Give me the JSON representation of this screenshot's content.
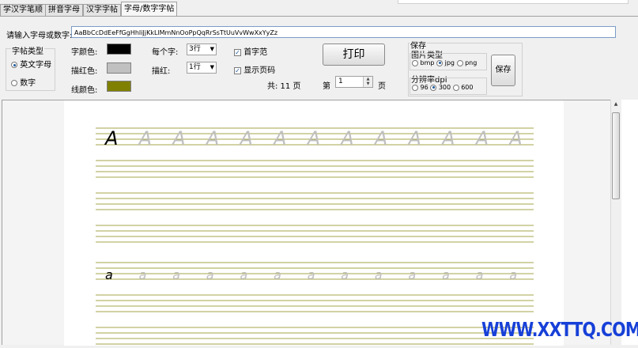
{
  "tabs": [
    {
      "label": "学汉字笔顺",
      "active": false
    },
    {
      "label": "拼音字母",
      "active": false
    },
    {
      "label": "汉字字帖",
      "active": false
    },
    {
      "label": "字母/数字字帖",
      "active": true
    }
  ],
  "input": {
    "label": "请输入字母或数字:",
    "value": "AaBbCcDdEeFfGgHhIiJjKkLlMmNnOoPpQqRrSsTtUuVvWwXxYyZz"
  },
  "type_group": {
    "title": "字帖类型",
    "options": [
      "英文字母",
      "数字"
    ],
    "selected": 0
  },
  "colors": {
    "char_label": "字颜色:",
    "char_color": "#000000",
    "trace_label": "描红色:",
    "trace_color": "#c0c0c0",
    "line_label": "线颜色:",
    "line_color": "#808000"
  },
  "per_char": {
    "label": "每个字:",
    "value": "3行"
  },
  "trace": {
    "label": "描红:",
    "value": "1行"
  },
  "first_char": {
    "label": "首字范",
    "checked": true
  },
  "show_page": {
    "label": "显示页码",
    "checked": true
  },
  "print_label": "打印",
  "pages": {
    "total_label": "共: 11 页",
    "page_prefix": "第",
    "current": "1",
    "page_suffix": "页"
  },
  "save": {
    "title": "保存",
    "img_type_title": "图片类型",
    "img_types": [
      "bmp",
      "jpg",
      "png"
    ],
    "img_selected": 1,
    "dpi_title": "分辨率dpi",
    "dpis": [
      "96",
      "300",
      "600"
    ],
    "dpi_selected": 1,
    "button_label": "保存"
  },
  "preview": {
    "rows": [
      {
        "model": "A",
        "trace": "A",
        "count": 13
      },
      {
        "model": "a",
        "trace": "a",
        "count": 13
      }
    ]
  },
  "watermark": "WWW.XXTTQ.COM"
}
